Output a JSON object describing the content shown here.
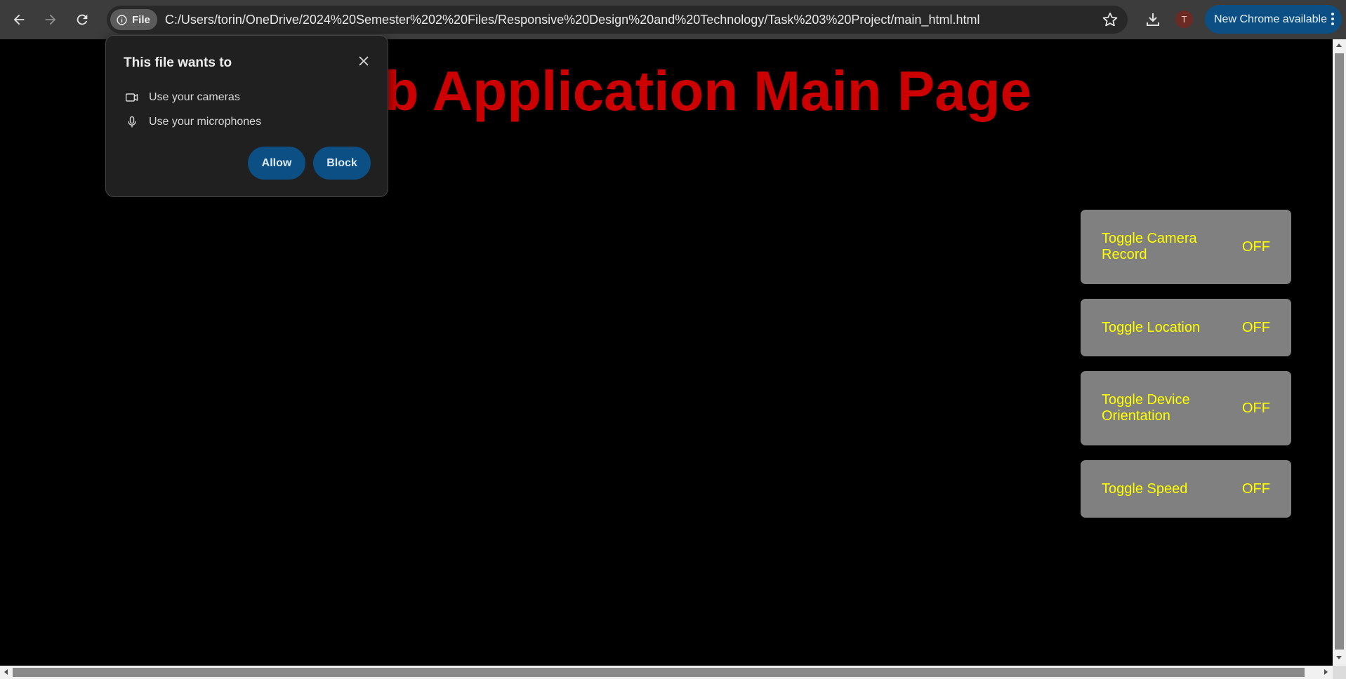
{
  "browser": {
    "file_chip_label": "File",
    "url": "C:/Users/torin/OneDrive/2024%20Semester%202%20Files/Responsive%20Design%20and%20Technology/Task%203%20Project/main_html.html",
    "avatar_letter": "T",
    "update_label": "New Chrome available",
    "icons": [
      "back-icon",
      "forward-icon",
      "reload-icon",
      "info-icon",
      "star-icon",
      "download-icon",
      "more-vert-icon"
    ]
  },
  "page": {
    "title": "Web Application Main Page",
    "title_color": "#cc0000",
    "toggles": [
      {
        "label": "Toggle Camera Record",
        "state": "OFF"
      },
      {
        "label": "Toggle Location",
        "state": "OFF"
      },
      {
        "label": "Toggle Device Orientation",
        "state": "OFF"
      },
      {
        "label": "Toggle Speed",
        "state": "OFF"
      }
    ],
    "toggle_bg": "#808080",
    "toggle_text_color": "#ffff00"
  },
  "permission_popup": {
    "title": "This file wants to",
    "items": [
      {
        "label": "Use your cameras",
        "icon": "camera-icon"
      },
      {
        "label": "Use your microphones",
        "icon": "microphone-icon"
      }
    ],
    "allow_label": "Allow",
    "block_label": "Block"
  }
}
